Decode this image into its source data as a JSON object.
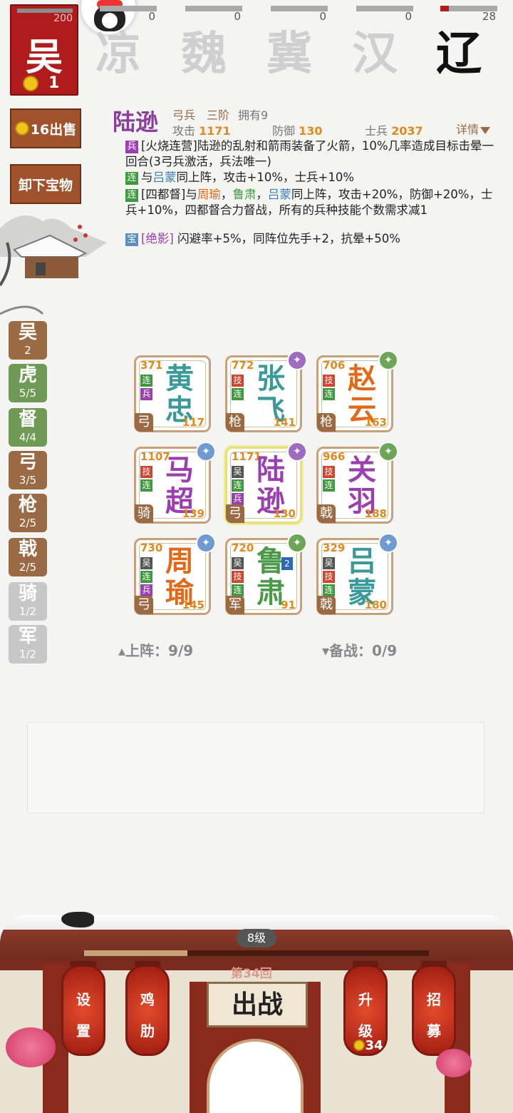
{
  "factions": {
    "wu": {
      "name": "吴",
      "value": "200",
      "coins": "1"
    },
    "others": [
      {
        "name": "凉",
        "value": "0",
        "fill": 0
      },
      {
        "name": "魏",
        "value": "0",
        "fill": 0
      },
      {
        "name": "冀",
        "value": "0",
        "fill": 0
      },
      {
        "name": "汉",
        "value": "0",
        "fill": 0
      },
      {
        "name": "辽",
        "value": "28",
        "fill": 0.15
      }
    ]
  },
  "side": {
    "sell_label": "16出售",
    "unequip_label": "卸下宝物"
  },
  "filters": [
    {
      "t": "吴",
      "c": "2",
      "style": "brown"
    },
    {
      "t": "虎",
      "c": "5/5",
      "style": "green"
    },
    {
      "t": "督",
      "c": "4/4",
      "style": "green"
    },
    {
      "t": "弓",
      "c": "3/5",
      "style": "brown"
    },
    {
      "t": "枪",
      "c": "2/5",
      "style": "brown"
    },
    {
      "t": "戟",
      "c": "2/5",
      "style": "brown"
    },
    {
      "t": "骑",
      "c": "1/2",
      "style": "grey"
    },
    {
      "t": "军",
      "c": "1/2",
      "style": "grey"
    }
  ],
  "hero": {
    "name": "陆逊",
    "type": "弓兵",
    "rank": "三阶",
    "owned": "拥有9",
    "atk_label": "攻击",
    "atk": "1171",
    "def_label": "防御",
    "def": "130",
    "soldier_label": "士兵",
    "soldier": "2037",
    "detail_label": "详情",
    "skills": {
      "bing_tag": "兵",
      "bing_text": "[火烧连营]陆逊的乱射和箭雨装备了火箭，10%几率造成目标击晕一回合(3弓兵激活，兵法唯一)",
      "lian1_tag": "连",
      "lian1_a": "与",
      "lian1_name": "吕蒙",
      "lian1_b": "同上阵，攻击+10%，士兵+10%",
      "lian2_tag": "连",
      "lian2_a": "[四都督]与",
      "lian2_n1": "周瑜",
      "lian2_sep1": "，",
      "lian2_n2": "鲁肃",
      "lian2_sep2": "，",
      "lian2_n3": "吕蒙",
      "lian2_b": "同上阵，攻击+20%，防御+20%，士兵+10%，四都督合力督战，所有的兵种技能个数需求减1",
      "bao_tag": "宝",
      "bao_name": "[绝影]",
      "bao_text": " 闪避率+5%，同阵位先手+2，抗晕+50%"
    }
  },
  "cards": [
    {
      "n1": "黄",
      "n2": "忠",
      "atk": "371",
      "hp": "117",
      "unit": "弓",
      "color": "teal",
      "tags": [
        "连",
        "兵"
      ],
      "badge": ""
    },
    {
      "n1": "张",
      "n2": "飞",
      "atk": "772",
      "hp": "141",
      "unit": "枪",
      "color": "teal",
      "tags": [
        "技",
        "连"
      ],
      "badge": "purple"
    },
    {
      "n1": "赵",
      "n2": "云",
      "atk": "706",
      "hp": "163",
      "unit": "枪",
      "color": "orange",
      "tags": [
        "技",
        "连"
      ],
      "badge": "green"
    },
    {
      "n1": "马",
      "n2": "超",
      "atk": "1107",
      "hp": "139",
      "unit": "骑",
      "color": "purple",
      "tags": [
        "技",
        "连"
      ],
      "badge": "blue"
    },
    {
      "n1": "陆",
      "n2": "逊",
      "atk": "1171",
      "hp": "130",
      "unit": "弓",
      "color": "purple",
      "tags": [
        "吴",
        "连",
        "兵"
      ],
      "badge": "purple",
      "selected": true
    },
    {
      "n1": "关",
      "n2": "羽",
      "atk": "966",
      "hp": "188",
      "unit": "戟",
      "color": "purple",
      "tags": [
        "技",
        "连"
      ],
      "badge": "green"
    },
    {
      "n1": "周",
      "n2": "瑜",
      "atk": "730",
      "hp": "145",
      "unit": "弓",
      "color": "orange",
      "tags": [
        "吴",
        "连",
        "兵"
      ],
      "badge": "blue"
    },
    {
      "n1": "鲁",
      "n2": "肃",
      "atk": "720",
      "hp": "91",
      "unit": "军",
      "color": "green",
      "tags": [
        "吴",
        "技",
        "连"
      ],
      "badge": "green",
      "lvl": "2"
    },
    {
      "n1": "吕",
      "n2": "蒙",
      "atk": "329",
      "hp": "180",
      "unit": "戟",
      "color": "teal",
      "tags": [
        "吴",
        "技",
        "连"
      ],
      "badge": "blue"
    }
  ],
  "lineup": {
    "on_label": "▴上阵：9/9",
    "reserve_label": "▾备战：0/9"
  },
  "palace": {
    "level": "8级",
    "round": "第34回",
    "battle": "出战",
    "settings_1": "设",
    "settings_2": "置",
    "chicken_1": "鸡",
    "chicken_2": "肋",
    "upgrade_1": "升",
    "upgrade_2": "级",
    "upgrade_cost": "34",
    "recruit_1": "招",
    "recruit_2": "募",
    "exp_fraction": 0.3
  }
}
